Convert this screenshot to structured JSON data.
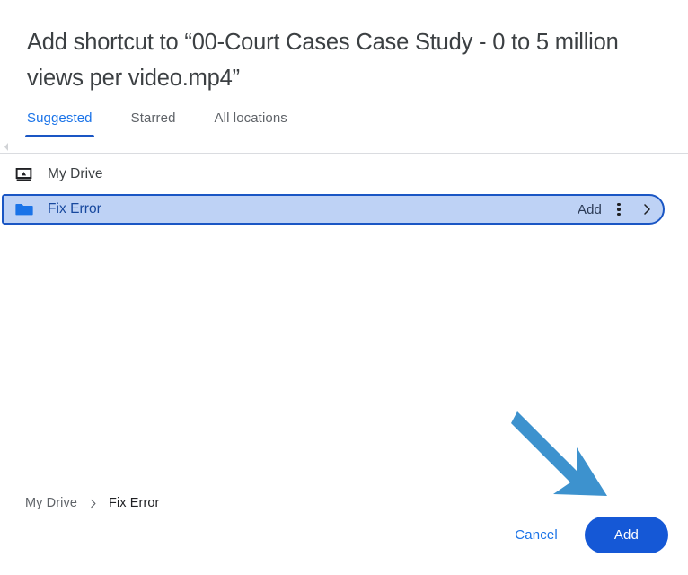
{
  "dialog": {
    "title": "Add shortcut to “00-Court Cases Case Study - 0 to 5 million views per video.mp4”",
    "tabs": [
      {
        "label": "Suggested",
        "active": true
      },
      {
        "label": "Starred",
        "active": false
      },
      {
        "label": "All locations",
        "active": false
      }
    ],
    "scroll": {
      "left_arrow_icon": "chevron-left-icon",
      "right_arrow_icon": "chevron-right-icon"
    },
    "list": {
      "rows": [
        {
          "icon": "hard-drive-icon",
          "label": "My Drive",
          "selected": false
        },
        {
          "icon": "folder-icon",
          "label": "Fix Error",
          "selected": true,
          "add_label": "Add",
          "kebab_icon": "more-vert-icon",
          "chevron_icon": "chevron-right-icon"
        }
      ]
    },
    "breadcrumb": {
      "separator_icon": "chevron-right-icon",
      "items": [
        {
          "label": "My Drive",
          "current": false
        },
        {
          "label": "Fix Error",
          "current": true
        }
      ]
    },
    "footer": {
      "cancel_label": "Cancel",
      "add_label": "Add"
    }
  },
  "annotation": {
    "arrow_icon": "arrow-down-right-icon",
    "arrow_color": "#3d92ce"
  },
  "colors": {
    "accent_blue": "#1a73e8",
    "button_blue": "#1558d6",
    "tab_underline": "#1a56c4",
    "row_selected_bg": "#bed2f5",
    "row_selected_border": "#1a56c4",
    "folder_blue": "#1a73e8",
    "title_text": "#3c4043",
    "muted_text": "#5f6368",
    "divider": "#dadce0"
  }
}
